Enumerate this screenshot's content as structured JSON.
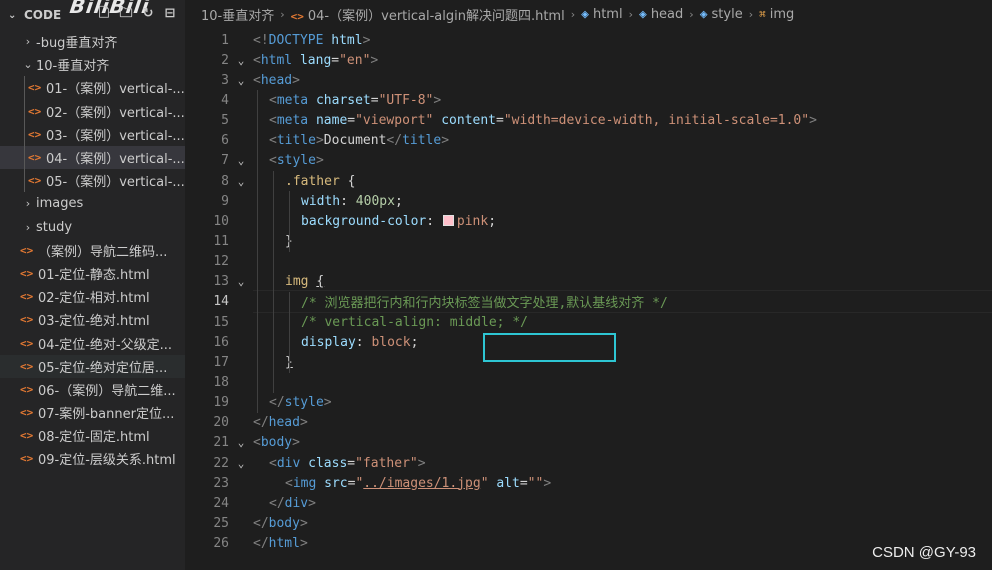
{
  "brand_overlay": "BiliBili",
  "sidebar": {
    "title": "CODE",
    "action_icons": [
      "new-file-icon",
      "new-folder-icon",
      "refresh-icon",
      "collapse-all-icon"
    ],
    "items": [
      {
        "label": "-bug垂直对齐",
        "type": "folder",
        "expanded": false,
        "level": 1
      },
      {
        "label": "10-垂直对齐",
        "type": "folder",
        "expanded": true,
        "level": 1
      },
      {
        "label": "01-（案例）vertical-...",
        "type": "file",
        "level": 2
      },
      {
        "label": "02-（案例）vertical-...",
        "type": "file",
        "level": 2
      },
      {
        "label": "03-（案例）vertical-...",
        "type": "file",
        "level": 2
      },
      {
        "label": "04-（案例）vertical-...",
        "type": "file",
        "level": 2,
        "selected": true
      },
      {
        "label": "05-（案例）vertical-...",
        "type": "file",
        "level": 2
      },
      {
        "label": "images",
        "type": "folder",
        "expanded": false,
        "level": 1
      },
      {
        "label": "study",
        "type": "folder",
        "expanded": false,
        "level": 1
      },
      {
        "label": "（案例）导航二维码...",
        "type": "file",
        "level": 1
      },
      {
        "label": "01-定位-静态.html",
        "type": "file",
        "level": 1
      },
      {
        "label": "02-定位-相对.html",
        "type": "file",
        "level": 1
      },
      {
        "label": "03-定位-绝对.html",
        "type": "file",
        "level": 1
      },
      {
        "label": "04-定位-绝对-父级定...",
        "type": "file",
        "level": 1
      },
      {
        "label": "05-定位-绝对定位居...",
        "type": "file",
        "level": 1,
        "hovered": true
      },
      {
        "label": "06-（案例）导航二维...",
        "type": "file",
        "level": 1
      },
      {
        "label": "07-案例-banner定位...",
        "type": "file",
        "level": 1
      },
      {
        "label": "08-定位-固定.html",
        "type": "file",
        "level": 1
      },
      {
        "label": "09-定位-层级关系.html",
        "type": "file",
        "level": 1
      }
    ]
  },
  "breadcrumbs": [
    {
      "label": "10-垂直对齐",
      "icon": ""
    },
    {
      "label": "04-（案例）vertical-algin解决问题四.html",
      "icon": "html-file-icon"
    },
    {
      "label": "html",
      "icon": "element-cube-icon"
    },
    {
      "label": "head",
      "icon": "element-cube-icon"
    },
    {
      "label": "style",
      "icon": "element-cube-icon"
    },
    {
      "label": "img",
      "icon": "css-selector-icon"
    }
  ],
  "editor": {
    "active_line": 14,
    "lines": [
      {
        "n": "1",
        "fold": "",
        "indent": 0,
        "tokens": [
          [
            "<!",
            "br"
          ],
          [
            "DOCTYPE",
            "tag"
          ],
          [
            " ",
            "txt"
          ],
          [
            "html",
            "attr"
          ],
          [
            ">",
            "br"
          ]
        ]
      },
      {
        "n": "2",
        "fold": "v",
        "indent": 0,
        "tokens": [
          [
            "<",
            "br"
          ],
          [
            "html",
            "tag"
          ],
          [
            " ",
            "txt"
          ],
          [
            "lang",
            "attr"
          ],
          [
            "=",
            "txt"
          ],
          [
            "\"en\"",
            "str"
          ],
          [
            ">",
            "br"
          ]
        ]
      },
      {
        "n": "3",
        "fold": "v",
        "indent": 0,
        "tokens": [
          [
            "<",
            "br"
          ],
          [
            "head",
            "tag"
          ],
          [
            ">",
            "br"
          ]
        ]
      },
      {
        "n": "4",
        "fold": "",
        "indent": 1,
        "tokens": [
          [
            "<",
            "br"
          ],
          [
            "meta",
            "tag"
          ],
          [
            " ",
            "txt"
          ],
          [
            "charset",
            "attr"
          ],
          [
            "=",
            "txt"
          ],
          [
            "\"UTF-8\"",
            "str"
          ],
          [
            ">",
            "br"
          ]
        ]
      },
      {
        "n": "5",
        "fold": "",
        "indent": 1,
        "tokens": [
          [
            "<",
            "br"
          ],
          [
            "meta",
            "tag"
          ],
          [
            " ",
            "txt"
          ],
          [
            "name",
            "attr"
          ],
          [
            "=",
            "txt"
          ],
          [
            "\"viewport\"",
            "str"
          ],
          [
            " ",
            "txt"
          ],
          [
            "content",
            "attr"
          ],
          [
            "=",
            "txt"
          ],
          [
            "\"width=device-width, initial-scale=1.0\"",
            "str"
          ],
          [
            ">",
            "br"
          ]
        ]
      },
      {
        "n": "6",
        "fold": "",
        "indent": 1,
        "tokens": [
          [
            "<",
            "br"
          ],
          [
            "title",
            "tag"
          ],
          [
            ">",
            "br"
          ],
          [
            "Document",
            "txt"
          ],
          [
            "</",
            "br"
          ],
          [
            "title",
            "tag"
          ],
          [
            ">",
            "br"
          ]
        ]
      },
      {
        "n": "7",
        "fold": "v",
        "indent": 1,
        "tokens": [
          [
            "<",
            "br"
          ],
          [
            "style",
            "tag"
          ],
          [
            ">",
            "br"
          ]
        ]
      },
      {
        "n": "8",
        "fold": "v",
        "indent": 2,
        "tokens": [
          [
            ".father",
            "sel"
          ],
          [
            " {",
            "punc"
          ]
        ]
      },
      {
        "n": "9",
        "fold": "",
        "indent": 3,
        "tokens": [
          [
            "width",
            "prop"
          ],
          [
            ": ",
            "punc"
          ],
          [
            "400px",
            "num"
          ],
          [
            ";",
            "punc"
          ]
        ]
      },
      {
        "n": "10",
        "fold": "",
        "indent": 3,
        "tokens": [
          [
            "background-color",
            "prop"
          ],
          [
            ": ",
            "punc"
          ],
          [
            "SWATCH",
            "swatch"
          ],
          [
            "pink",
            "val"
          ],
          [
            ";",
            "punc"
          ]
        ]
      },
      {
        "n": "11",
        "fold": "",
        "indent": 2,
        "tokens": [
          [
            "}",
            "punc"
          ]
        ]
      },
      {
        "n": "12",
        "fold": "",
        "indent": 0,
        "tokens": []
      },
      {
        "n": "13",
        "fold": "v",
        "indent": 2,
        "tokens": [
          [
            "img",
            "sel"
          ],
          [
            " ",
            "punc"
          ],
          [
            "{",
            "punc-ul"
          ]
        ]
      },
      {
        "n": "14",
        "fold": "",
        "indent": 3,
        "tokens": [
          [
            "/* 浏览器把行内和行内块标签当做文字处理,默认基线对齐 */",
            "com"
          ]
        ]
      },
      {
        "n": "15",
        "fold": "",
        "indent": 3,
        "tokens": [
          [
            "/* vertical-align: middle; */",
            "com"
          ]
        ]
      },
      {
        "n": "16",
        "fold": "",
        "indent": 3,
        "tokens": [
          [
            "display",
            "prop"
          ],
          [
            ": ",
            "punc"
          ],
          [
            "block",
            "val"
          ],
          [
            ";",
            "punc"
          ]
        ]
      },
      {
        "n": "17",
        "fold": "",
        "indent": 2,
        "tokens": [
          [
            "}",
            "punc-ul"
          ]
        ]
      },
      {
        "n": "18",
        "fold": "",
        "indent": 0,
        "tokens": []
      },
      {
        "n": "19",
        "fold": "",
        "indent": 1,
        "tokens": [
          [
            "</",
            "br"
          ],
          [
            "style",
            "tag"
          ],
          [
            ">",
            "br"
          ]
        ]
      },
      {
        "n": "20",
        "fold": "",
        "indent": 0,
        "tokens": [
          [
            "</",
            "br"
          ],
          [
            "head",
            "tag"
          ],
          [
            ">",
            "br"
          ]
        ]
      },
      {
        "n": "21",
        "fold": "v",
        "indent": 0,
        "tokens": [
          [
            "<",
            "br"
          ],
          [
            "body",
            "tag"
          ],
          [
            ">",
            "br"
          ]
        ]
      },
      {
        "n": "22",
        "fold": "v",
        "indent": 1,
        "tokens": [
          [
            "<",
            "br"
          ],
          [
            "div",
            "tag"
          ],
          [
            " ",
            "txt"
          ],
          [
            "class",
            "attr"
          ],
          [
            "=",
            "txt"
          ],
          [
            "\"father\"",
            "str"
          ],
          [
            ">",
            "br"
          ]
        ]
      },
      {
        "n": "23",
        "fold": "",
        "indent": 2,
        "tokens": [
          [
            "<",
            "br"
          ],
          [
            "img",
            "tag"
          ],
          [
            " ",
            "txt"
          ],
          [
            "src",
            "attr"
          ],
          [
            "=",
            "txt"
          ],
          [
            "\"",
            "str"
          ],
          [
            "../images/1.jpg",
            "str-ul"
          ],
          [
            "\"",
            "str"
          ],
          [
            " ",
            "txt"
          ],
          [
            "alt",
            "attr"
          ],
          [
            "=",
            "txt"
          ],
          [
            "\"\"",
            "str"
          ],
          [
            ">",
            "br"
          ]
        ]
      },
      {
        "n": "24",
        "fold": "",
        "indent": 1,
        "tokens": [
          [
            "</",
            "br"
          ],
          [
            "div",
            "tag"
          ],
          [
            ">",
            "br"
          ]
        ]
      },
      {
        "n": "25",
        "fold": "",
        "indent": 0,
        "tokens": [
          [
            "</",
            "br"
          ],
          [
            "body",
            "tag"
          ],
          [
            ">",
            "br"
          ]
        ]
      },
      {
        "n": "26",
        "fold": "",
        "indent": 0,
        "tokens": [
          [
            "</",
            "br"
          ],
          [
            "html",
            "tag"
          ],
          [
            ">",
            "br"
          ]
        ]
      }
    ]
  },
  "colors": {
    "highlight_box": "#2ec6d3",
    "swatch_pink": "#ffc0cb",
    "file_icon": "#e37933"
  },
  "watermark": "CSDN @GY-93"
}
